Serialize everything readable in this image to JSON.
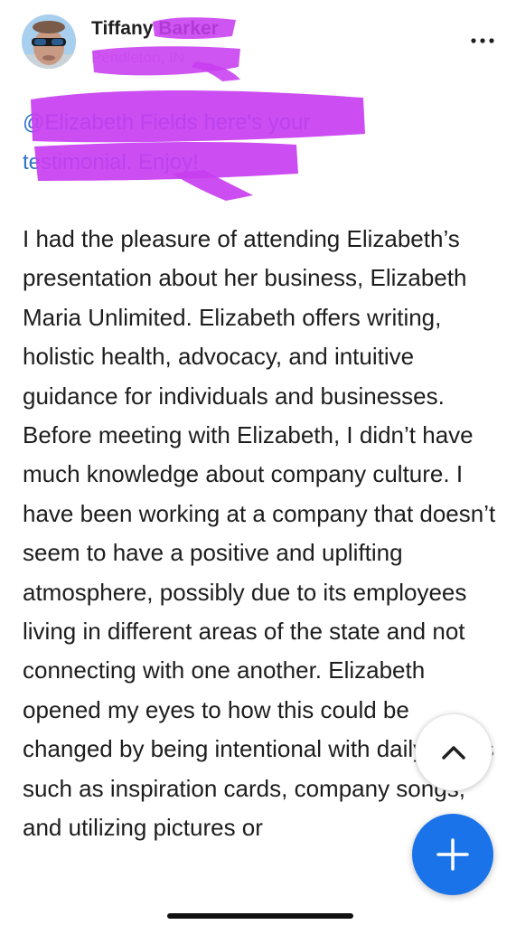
{
  "post": {
    "author": {
      "name": "Tiffany Barker",
      "subtitle": "Pendleton, IN"
    },
    "mention": {
      "text": "@Elizabeth Fields here's your testimonial. Enjoy!"
    },
    "body": "I had the pleasure of attending Elizabeth’s presentation about her business, Elizabeth Maria Unlimited. Elizabeth offers writing, holistic health, advocacy, and intuitive guidance for individuals and businesses. Before meeting with Elizabeth, I didn’t have much knowledge about company culture. I have been working at a company that doesn’t seem to have a positive and uplifting atmosphere, possibly due to its employees living in different areas of the state and not connecting with one another. Elizabeth opened my eyes to how this could be changed by being intentional with daily habits such as inspiration cards, company songs, and utilizing pictures or"
  },
  "icons": {
    "more": "more-horizontal-icon",
    "scroll_top": "chevron-up-icon",
    "add": "plus-icon"
  },
  "colors": {
    "link": "#2f71c8",
    "fab": "#1a73e8",
    "redaction": "#c83ef0"
  }
}
